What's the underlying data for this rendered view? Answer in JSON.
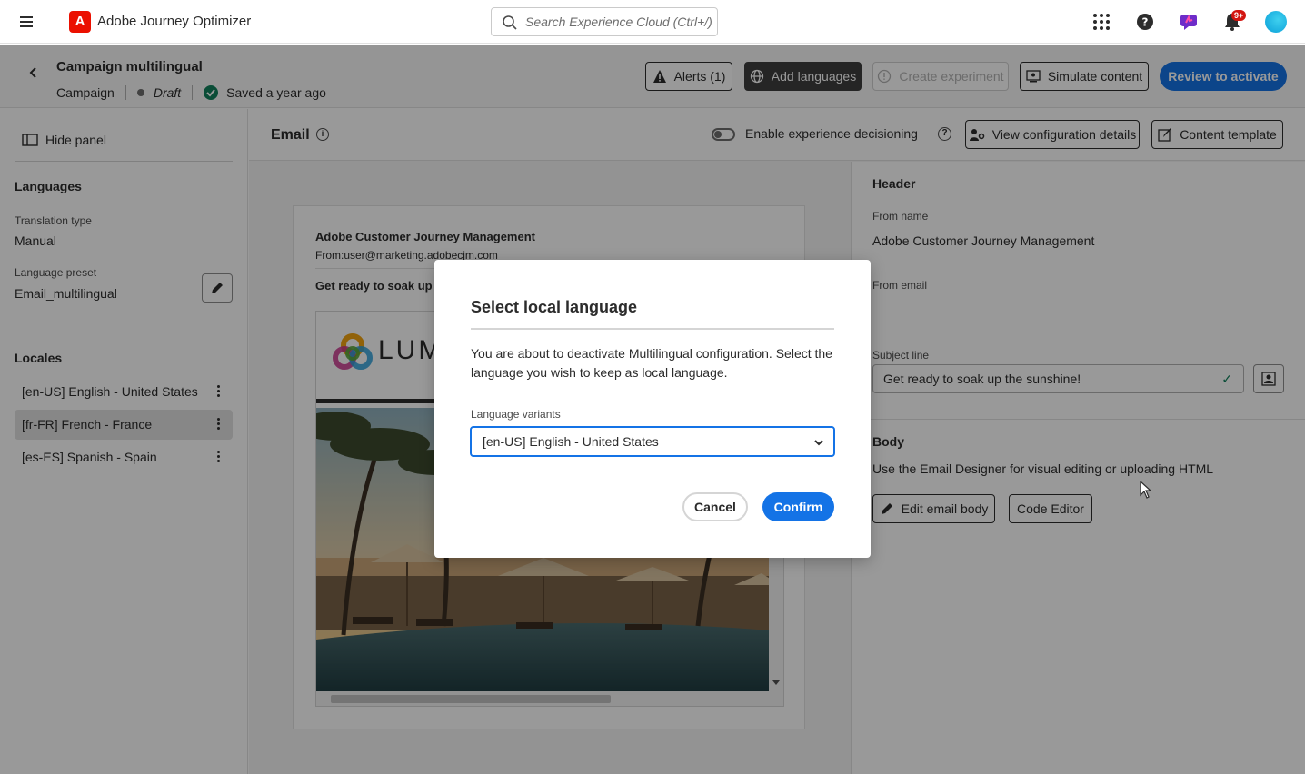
{
  "topbar": {
    "app_name": "Adobe Journey Optimizer",
    "search_placeholder": "Search Experience Cloud (Ctrl+/)",
    "notification_badge": "9+",
    "icons": [
      "menu-icon",
      "apps-grid-icon",
      "help-icon",
      "feedback-icon",
      "bell-icon",
      "avatar"
    ]
  },
  "campaign": {
    "title": "Campaign multilingual",
    "type": "Campaign",
    "status": "Draft",
    "saved": "Saved a year ago"
  },
  "actions": {
    "alerts": "Alerts (1)",
    "add_languages": "Add languages",
    "create_experiment": "Create experiment",
    "simulate_content": "Simulate content",
    "review_to_activate": "Review to activate"
  },
  "left_panel": {
    "hide_panel": "Hide panel",
    "languages_title": "Languages",
    "translation_type_label": "Translation type",
    "translation_type_value": "Manual",
    "language_preset_label": "Language preset",
    "language_preset_value": "Email_multilingual",
    "locales_title": "Locales",
    "locales": [
      {
        "label": "[en-US] English - United States"
      },
      {
        "label": "[fr-FR] French - France"
      },
      {
        "label": "[es-ES] Spanish - Spain"
      }
    ]
  },
  "editor": {
    "title": "Email",
    "enable_decisioning": "Enable experience decisioning",
    "view_config": "View configuration details",
    "content_template": "Content template"
  },
  "preview": {
    "from_name": "Adobe Customer Journey Management",
    "from_email": "From:user@marketing.adobecjm.com",
    "subject": "Get ready to soak up the sunshine!",
    "brand": "LUMA"
  },
  "form": {
    "header_title": "Header",
    "from_name_label": "From name",
    "from_name_value": "Adobe Customer Journey Management",
    "from_email_label": "From email",
    "subject_label": "Subject line",
    "subject_value": "Get ready to soak up the sunshine!",
    "body_title": "Body",
    "body_hint": "Use the Email Designer for visual editing or uploading HTML",
    "edit_email_body": "Edit email body",
    "code_editor": "Code Editor"
  },
  "dialog": {
    "title": "Select local language",
    "body": "You are about to deactivate Multilingual configuration. Select the language you wish to keep as local language.",
    "field_label": "Language variants",
    "selected_value": "[en-US] English - United States",
    "cancel": "Cancel",
    "confirm": "Confirm"
  },
  "colors": {
    "accent": "#1473e6",
    "adobe_red": "#eb1000",
    "success": "#12805c"
  }
}
